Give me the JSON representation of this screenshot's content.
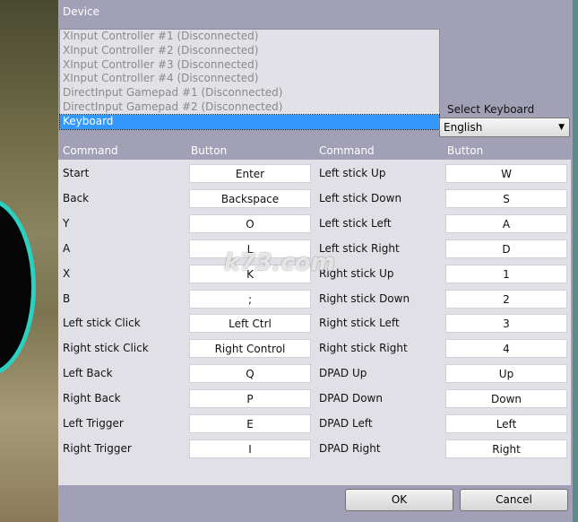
{
  "device": {
    "label": "Device",
    "items": [
      "XInput Controller #1 (Disconnected)",
      "XInput Controller #2 (Disconnected)",
      "XInput Controller #3 (Disconnected)",
      "XInput Controller #4 (Disconnected)",
      "DirectInput Gamepad #1 (Disconnected)",
      "DirectInput Gamepad #2 (Disconnected)",
      "Keyboard"
    ],
    "selected": "Keyboard"
  },
  "layout": {
    "label": "Select Keyboard Layout",
    "value": "English"
  },
  "headers": [
    "Command",
    "Button",
    "Command",
    "Button"
  ],
  "left": [
    [
      "Start",
      "Enter"
    ],
    [
      "Back",
      "Backspace"
    ],
    [
      "Y",
      "O"
    ],
    [
      "A",
      "L"
    ],
    [
      "X",
      "K"
    ],
    [
      "B",
      ";"
    ],
    [
      "Left stick Click",
      "Left Ctrl"
    ],
    [
      "Right stick Click",
      "Right Control"
    ],
    [
      "Left Back",
      "Q"
    ],
    [
      "Right Back",
      "P"
    ],
    [
      "Left Trigger",
      "E"
    ],
    [
      "Right Trigger",
      "I"
    ]
  ],
  "right": [
    [
      "Left stick Up",
      "W"
    ],
    [
      "Left stick Down",
      "S"
    ],
    [
      "Left stick Left",
      "A"
    ],
    [
      "Left stick Right",
      "D"
    ],
    [
      "Right stick Up",
      "1"
    ],
    [
      "Right stick Down",
      "2"
    ],
    [
      "Right stick Left",
      "3"
    ],
    [
      "Right stick Right",
      "4"
    ],
    [
      "DPAD Up",
      "Up"
    ],
    [
      "DPAD Down",
      "Down"
    ],
    [
      "DPAD Left",
      "Left"
    ],
    [
      "DPAD Right",
      "Right"
    ]
  ],
  "buttons": {
    "ok": "OK",
    "cancel": "Cancel"
  },
  "watermark": "k73.com"
}
